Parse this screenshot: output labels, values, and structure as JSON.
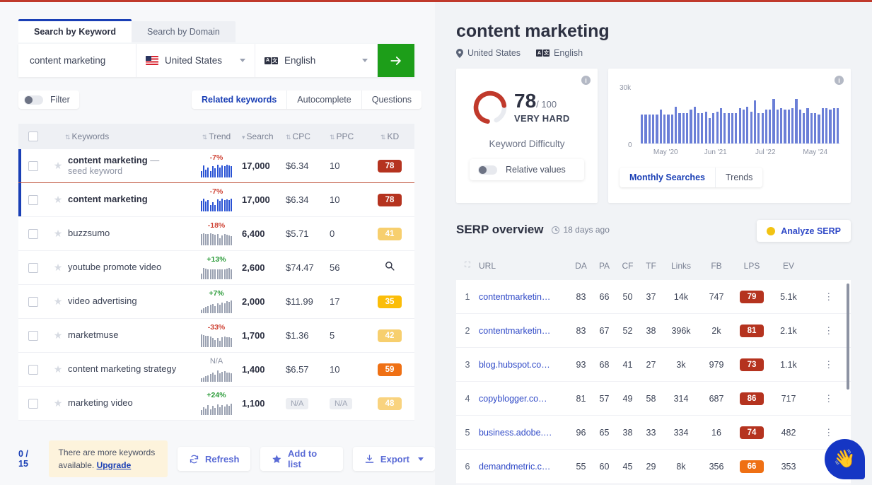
{
  "theme": {
    "accent": "#1a3fb5",
    "green": "#1d9e19",
    "topbar": "#c0392b"
  },
  "left": {
    "tabs": [
      {
        "label": "Search by Keyword",
        "active": true
      },
      {
        "label": "Search by Domain",
        "active": false
      }
    ],
    "search": {
      "value": "content marketing",
      "country": "United States",
      "language": "English",
      "go_icon": "arrow-right-icon"
    },
    "filter_label": "Filter",
    "modes": [
      {
        "label": "Related keywords",
        "active": true
      },
      {
        "label": "Autocomplete",
        "active": false
      },
      {
        "label": "Questions",
        "active": false
      }
    ],
    "columns": [
      "Keywords",
      "Trend",
      "Search",
      "CPC",
      "PPC",
      "KD"
    ],
    "rows": [
      {
        "keyword": "content marketing",
        "suffix": "—",
        "sub": "seed keyword",
        "bold": true,
        "trend": "-7%",
        "trend_dir": "down",
        "search": "17,000",
        "cpc": "$6.34",
        "ppc": "10",
        "kd": "78",
        "kd_color": "#b5331f",
        "selected": true,
        "seed": true,
        "spark_blue": true,
        "spark": [
          9,
          17,
          11,
          14,
          9,
          16,
          13,
          18,
          14,
          17,
          16,
          18,
          17,
          16
        ]
      },
      {
        "keyword": "content marketing",
        "suffix": "",
        "sub": "",
        "bold": true,
        "trend": "-7%",
        "trend_dir": "down",
        "search": "17,000",
        "cpc": "$6.34",
        "ppc": "10",
        "kd": "78",
        "kd_color": "#b5331f",
        "selected": true,
        "seed": false,
        "spark_blue": true,
        "spark": [
          15,
          18,
          14,
          16,
          9,
          13,
          9,
          17,
          15,
          18,
          16,
          17,
          16,
          18
        ]
      },
      {
        "keyword": "buzzsumo",
        "suffix": "",
        "sub": "",
        "bold": false,
        "trend": "-18%",
        "trend_dir": "down",
        "search": "6,400",
        "cpc": "$5.71",
        "ppc": "0",
        "kd": "41",
        "kd_color": "#f7cf6e",
        "selected": false,
        "seed": false,
        "spark_blue": false,
        "spark": [
          16,
          17,
          16,
          16,
          17,
          16,
          15,
          16,
          10,
          14,
          16,
          15,
          14,
          13
        ]
      },
      {
        "keyword": "youtube promote video",
        "suffix": "",
        "sub": "",
        "bold": false,
        "trend": "+13%",
        "trend_dir": "up",
        "search": "2,600",
        "cpc": "$74.47",
        "ppc": "56",
        "kd": "",
        "kd_icon": "magnifier-icon",
        "kd_color": "",
        "selected": false,
        "seed": false,
        "spark_blue": false,
        "spark": [
          8,
          16,
          15,
          14,
          14,
          14,
          14,
          14,
          14,
          14,
          14,
          15,
          16,
          14
        ]
      },
      {
        "keyword": "video advertising",
        "suffix": "",
        "sub": "",
        "bold": false,
        "trend": "+7%",
        "trend_dir": "up",
        "search": "2,000",
        "cpc": "$11.99",
        "ppc": "17",
        "kd": "35",
        "kd_color": "#fbbd08",
        "selected": false,
        "seed": false,
        "spark_blue": false,
        "spark": [
          5,
          7,
          9,
          10,
          12,
          13,
          10,
          14,
          12,
          15,
          14,
          17,
          16,
          18
        ]
      },
      {
        "keyword": "marketmuse",
        "suffix": "",
        "sub": "",
        "bold": false,
        "trend": "-33%",
        "trend_dir": "down",
        "search": "1,700",
        "cpc": "$1.36",
        "ppc": "5",
        "kd": "42",
        "kd_color": "#f7cf6e",
        "selected": false,
        "seed": false,
        "spark_blue": false,
        "spark": [
          18,
          17,
          16,
          16,
          15,
          13,
          10,
          13,
          9,
          14,
          15,
          14,
          14,
          13
        ]
      },
      {
        "keyword": "content marketing strategy",
        "suffix": "",
        "sub": "",
        "bold": false,
        "trend": "N/A",
        "trend_dir": "na",
        "search": "1,400",
        "cpc": "$6.57",
        "ppc": "10",
        "kd": "59",
        "kd_color": "#ef7014",
        "selected": false,
        "seed": false,
        "spark_blue": false,
        "spark": [
          5,
          6,
          8,
          9,
          11,
          13,
          10,
          16,
          12,
          14,
          15,
          13,
          13,
          12
        ]
      },
      {
        "keyword": "marketing video",
        "suffix": "",
        "sub": "",
        "bold": false,
        "trend": "+24%",
        "trend_dir": "up",
        "search": "1,100",
        "cpc": "N/A",
        "cpc_na": true,
        "ppc": "N/A",
        "ppc_na": true,
        "kd": "48",
        "kd_color": "#f9d37f",
        "selected": false,
        "seed": false,
        "spark_blue": false,
        "spark": [
          7,
          11,
          9,
          14,
          8,
          13,
          10,
          15,
          11,
          14,
          12,
          15,
          13,
          16
        ]
      }
    ],
    "footer": {
      "count": "0 / 15",
      "upgrade_text": "There are more keywords available. ",
      "upgrade_link": "Upgrade",
      "refresh": "Refresh",
      "add_to_list": "Add to list",
      "export": "Export"
    }
  },
  "right": {
    "title": "content marketing",
    "location": "United States",
    "language": "English",
    "kd_card": {
      "score": "78",
      "out_of": "/ 100",
      "verdict": "VERY HARD",
      "caption": "Keyword Difficulty",
      "toggle_label": "Relative values",
      "arc_color": "#c0392b",
      "info_icon": "info-icon"
    },
    "ms_card": {
      "tabs": [
        {
          "label": "Monthly Searches",
          "active": true
        },
        {
          "label": "Trends",
          "active": false
        }
      ],
      "info_icon": "info-icon"
    },
    "serp": {
      "title": "SERP overview",
      "updated": "18 days ago",
      "analyze_label": "Analyze SERP",
      "columns": [
        "URL",
        "DA",
        "PA",
        "CF",
        "TF",
        "Links",
        "FB",
        "LPS",
        "EV"
      ],
      "rows": [
        {
          "n": "1",
          "url": "contentmarketin…",
          "da": "83",
          "pa": "66",
          "cf": "50",
          "tf": "37",
          "links": "14k",
          "fb": "747",
          "lps": "79",
          "lps_color": "#b5331f",
          "ev": "5.1k"
        },
        {
          "n": "2",
          "url": "contentmarketin…",
          "da": "83",
          "pa": "67",
          "cf": "52",
          "tf": "38",
          "links": "396k",
          "fb": "2k",
          "lps": "81",
          "lps_color": "#b5331f",
          "ev": "2.1k"
        },
        {
          "n": "3",
          "url": "blog.hubspot.co…",
          "da": "93",
          "pa": "68",
          "cf": "41",
          "tf": "27",
          "links": "3k",
          "fb": "979",
          "lps": "73",
          "lps_color": "#b5331f",
          "ev": "1.1k"
        },
        {
          "n": "4",
          "url": "copyblogger.co…",
          "da": "81",
          "pa": "57",
          "cf": "49",
          "tf": "58",
          "links": "314",
          "fb": "687",
          "lps": "86",
          "lps_color": "#b5331f",
          "ev": "717"
        },
        {
          "n": "5",
          "url": "business.adobe.…",
          "da": "96",
          "pa": "65",
          "cf": "38",
          "tf": "33",
          "links": "334",
          "fb": "16",
          "lps": "74",
          "lps_color": "#b5331f",
          "ev": "482"
        },
        {
          "n": "6",
          "url": "demandmetric.c…",
          "da": "55",
          "pa": "60",
          "cf": "45",
          "tf": "29",
          "links": "8k",
          "fb": "356",
          "lps": "66",
          "lps_color": "#ef7014",
          "ev": "353"
        }
      ]
    },
    "chat_icon": "waving-hand-icon"
  },
  "chart_data": {
    "type": "bar",
    "title": "Monthly Searches",
    "ylabel": "",
    "xlabel": "",
    "ylim": [
      0,
      30000
    ],
    "ytick_labels": [
      "0",
      "30k"
    ],
    "xtick_labels": [
      "May '20",
      "Jun '21",
      "Jul '22",
      "May '24"
    ],
    "grid": false,
    "legend": "none",
    "bar_color": "#6b7fd7",
    "values": [
      18000,
      18000,
      18000,
      18000,
      18000,
      21000,
      18000,
      18000,
      18000,
      23000,
      19000,
      19000,
      19000,
      21000,
      23000,
      19000,
      19000,
      20000,
      16000,
      19000,
      20000,
      22000,
      19000,
      19000,
      19000,
      19000,
      22000,
      21000,
      23000,
      20000,
      27000,
      19000,
      19000,
      21000,
      21000,
      28000,
      21000,
      22000,
      21000,
      21000,
      22000,
      28000,
      21000,
      19000,
      22000,
      19000,
      19000,
      18000,
      22000,
      22000,
      21000,
      22000,
      22000
    ]
  }
}
